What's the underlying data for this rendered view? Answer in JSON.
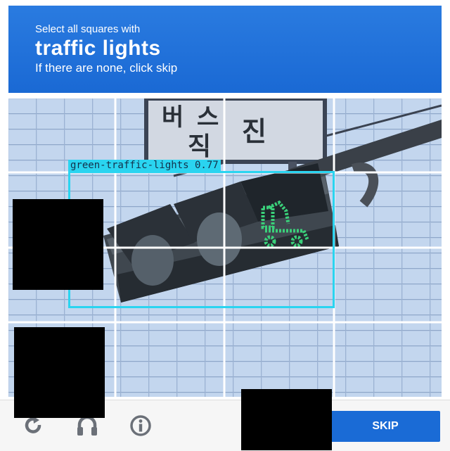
{
  "challenge": {
    "instruction": "Select all squares with",
    "target": "traffic lights",
    "hint": "If there are none, click skip"
  },
  "scene": {
    "sign_text": [
      "버",
      "스",
      "직",
      "진"
    ]
  },
  "grid": {
    "rows": 4,
    "cols": 4
  },
  "detection": {
    "label": "green-traffic-lights 0.77",
    "color": "#2ad4f0"
  },
  "footer": {
    "reload_icon": "reload-icon",
    "audio_icon": "headphones-icon",
    "info_icon": "info-icon",
    "skip_label": "SKIP"
  },
  "colors": {
    "header_blue": "#1a69d4",
    "skip_blue": "#1a6bd6",
    "box_cyan": "#2ad4f0",
    "signal_green": "#3ad07a"
  }
}
